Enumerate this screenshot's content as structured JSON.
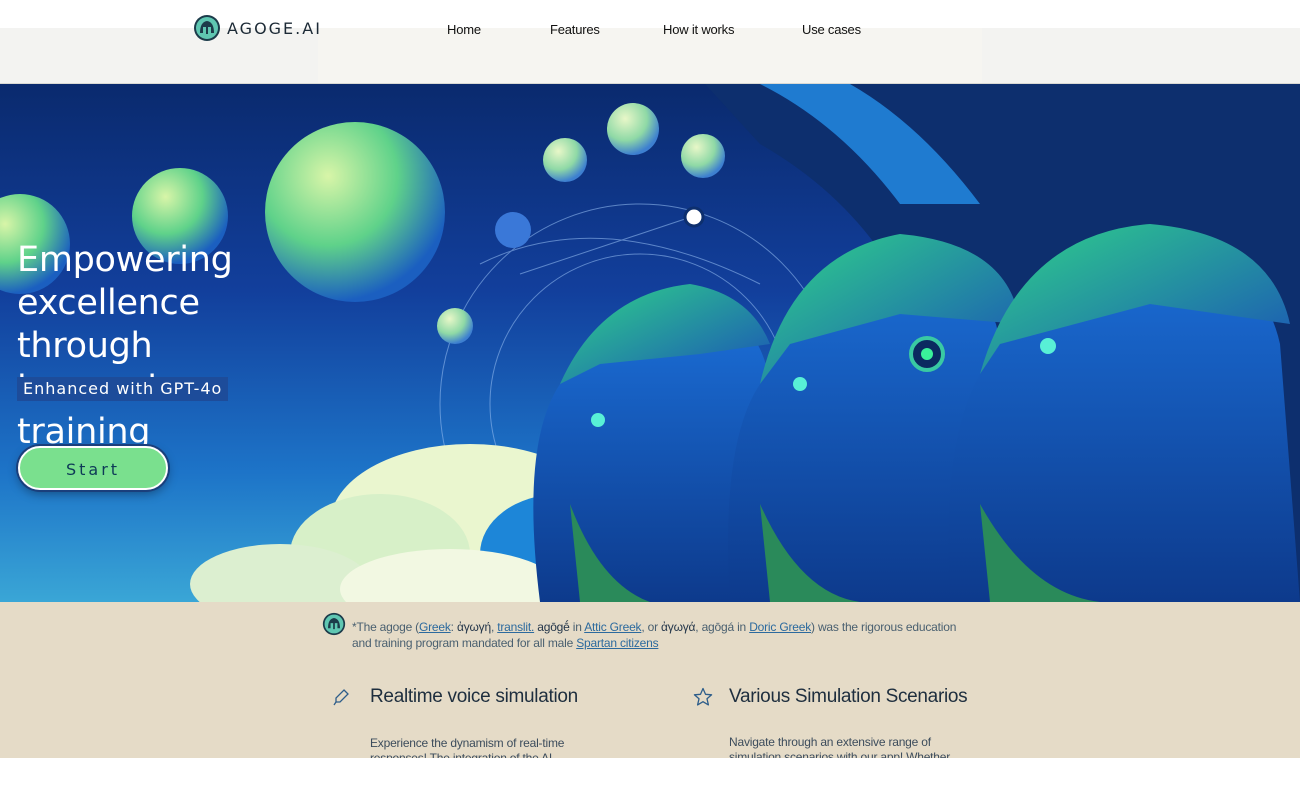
{
  "brand": {
    "name": "AGOGE.AI",
    "logo_icon": "helmet-logo-icon"
  },
  "nav": {
    "home": "Home",
    "features": "Features",
    "how_it_works": "How it works",
    "use_cases": "Use cases"
  },
  "hero": {
    "headline": "Empowering excellence through immersive training",
    "tagline": "Enhanced with GPT-4o",
    "cta": "Start"
  },
  "note": {
    "lead": "*The agoge (",
    "link_greek": "Greek",
    "greek_word": "ἀγωγή",
    "link_translit": "translit.",
    "translit_word": "agōgḗ",
    "in_1": "in",
    "link_attic": "Attic Greek",
    "or_word": ", or",
    "doric_greek_word": "ἀγωγά",
    "doric_translit": "agōgá",
    "in_2": "in",
    "link_doric": "Doric Greek",
    "rest": ") was the rigorous education and training program mandated for all male",
    "link_spartan": "Spartan citizens"
  },
  "features": [
    {
      "icon": "microphone-icon",
      "title": "Realtime voice simulation",
      "text": "Experience the dynamism of real-time responses! The integration of the AI..."
    },
    {
      "icon": "star-icon",
      "title": "Various Simulation Scenarios",
      "text": "Navigate through an extensive range of simulation scenarios with our app! Whether it's"
    }
  ],
  "colors": {
    "accent_green": "#7ae08e",
    "hero_blue": "#123f9c",
    "info_bg": "#e5dbc7",
    "tag_bg": "#1d4c9a"
  }
}
